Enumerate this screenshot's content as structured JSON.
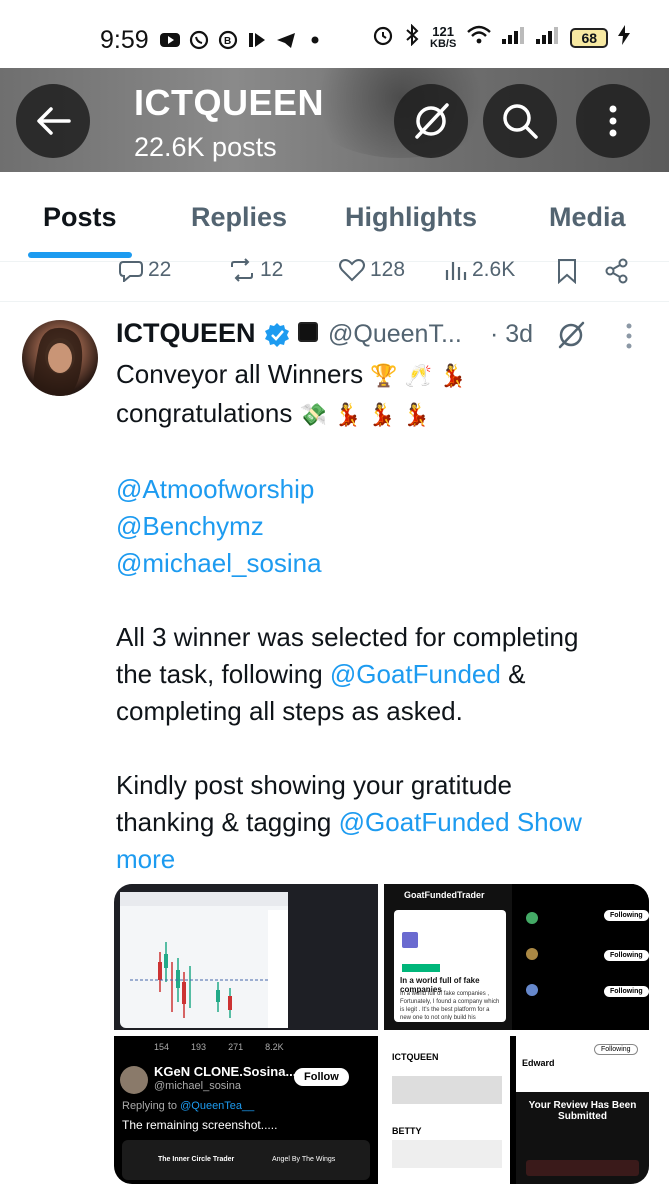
{
  "status_bar": {
    "time": "9:59",
    "net_speed_value": "121",
    "net_speed_unit": "KB/S",
    "battery": "68"
  },
  "header": {
    "title": "ICTQUEEN",
    "subtitle": "22.6K posts"
  },
  "tabs": [
    {
      "label": "Posts",
      "active": true
    },
    {
      "label": "Replies",
      "active": false
    },
    {
      "label": "Highlights",
      "active": false
    },
    {
      "label": "Media",
      "active": false
    }
  ],
  "prev_tweet_actions": {
    "replies": "22",
    "reposts": "12",
    "likes": "128",
    "views": "2.6K"
  },
  "tweet": {
    "name": "ICTQUEEN",
    "handle": "@QueenT...",
    "time": "· 3d",
    "line1": "Conveyor all Winners",
    "line1_emoji": "🏆 🥂 💃",
    "line2": "congratulations",
    "line2_emoji": "💸 💃 💃 💃",
    "mentions": [
      "@Atmoofworship",
      "@Benchymz",
      "@michael_sosina"
    ],
    "p2_a": "All 3 winner was selected for completing",
    "p2_b": "the task, following ",
    "p2_mention": "@GoatFunded",
    "p2_c": " &",
    "p2_d": "completing all steps as asked.",
    "p3_a": "Kindly post showing your gratitude",
    "p3_b": "thanking & tagging ",
    "p3_mention": "@GoatFunded",
    "show_more": "Show more"
  },
  "media": {
    "m2_title": "GoatFundedTrader",
    "m2_card_title": "In a world full of fake companies",
    "m2_card_body": "In a world full of fake companies , Fortunately, I found a company which is legit . It's the best platform for a new one to not only build his confidence with such a pure & straightforward rules",
    "m3_stats": [
      "154",
      "193",
      "271",
      "8.2K"
    ],
    "m3_name": "KGeN CLONE.Sosina...",
    "m3_handle": "@michael_sosina",
    "m3_follow": "Follow",
    "m3_replying": "Replying to",
    "m3_replying_to": "@QueenTea__",
    "m3_text": "The remaining screenshot.....",
    "m3_sub1": "The Inner Circle Trader",
    "m3_sub2": "Angel By The Wings",
    "m4_name": "ICTQUEEN",
    "m4_name2": "BETTY",
    "m4_user": "Edward",
    "m4_follow": "Following",
    "m4_review_title": "Your Review Has Been Submitted"
  },
  "colors": {
    "accent": "#1d9bf0",
    "text_primary": "#0f1419",
    "text_secondary": "#536471"
  }
}
